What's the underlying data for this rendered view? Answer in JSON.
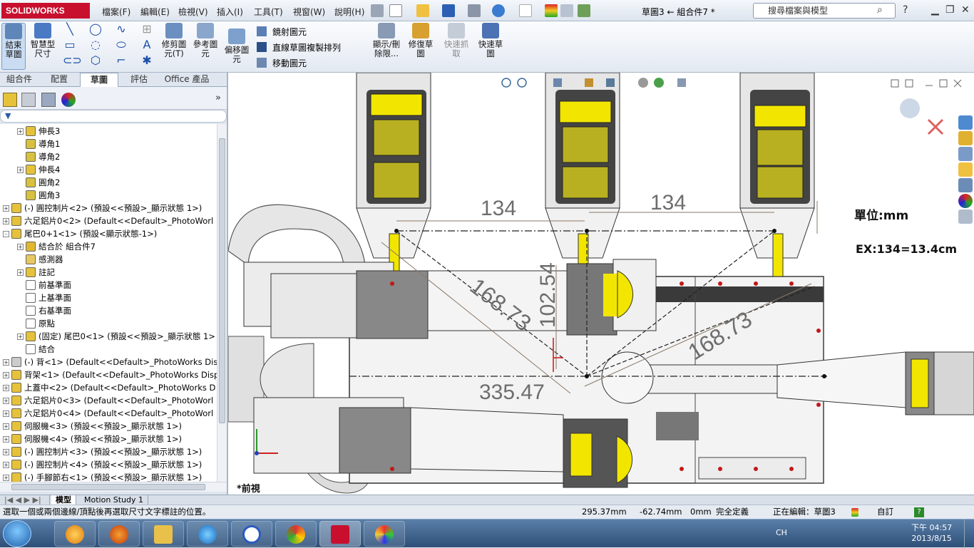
{
  "app": {
    "logo": "SOLIDWORKS",
    "menus": [
      "檔案(F)",
      "編輯(E)",
      "檢視(V)",
      "插入(I)",
      "工具(T)",
      "視窗(W)",
      "說明(H)"
    ],
    "doc_title": "草圖3 ← 組合件7 *",
    "search_placeholder": "搜尋檔案與模型"
  },
  "command_manager": {
    "exit_sketch": "結束草圖",
    "smart_dimension": "智慧型尺寸",
    "trim": "修剪圖元(T)",
    "convert": "參考圖元",
    "offset": "偏移圖元",
    "mirror": "鏡射圖元",
    "linear_pattern": "直線草圖複製排列",
    "move": "移動圖元",
    "display_delete": "顯示/刪除限...",
    "repair": "修復草圖",
    "quick_snap": "快速抓取",
    "rapid_sketch": "快速草圖"
  },
  "tabs": [
    "組合件",
    "配置",
    "草圖",
    "評估",
    "Office 產品"
  ],
  "active_tab": "草圖",
  "tree": [
    {
      "indent": 1,
      "label": "伸長3",
      "icon": "extrude",
      "expand": "+"
    },
    {
      "indent": 1,
      "label": "導角1",
      "icon": "chamfer",
      "expand": ""
    },
    {
      "indent": 1,
      "label": "導角2",
      "icon": "chamfer",
      "expand": ""
    },
    {
      "indent": 1,
      "label": "伸長4",
      "icon": "extrude",
      "expand": "+"
    },
    {
      "indent": 1,
      "label": "圓角2",
      "icon": "fillet",
      "expand": ""
    },
    {
      "indent": 1,
      "label": "圓角3",
      "icon": "fillet",
      "expand": ""
    },
    {
      "indent": 0,
      "label": "(-) 圓控制片<2> (預設<<預設>_顯示狀態 1>)",
      "icon": "part",
      "expand": "+"
    },
    {
      "indent": 0,
      "label": "六足鋁片0<2> (Default<<Default>_PhotoWorl",
      "icon": "part",
      "expand": "+"
    },
    {
      "indent": 0,
      "label": "尾巴0+1<1> (預設<顯示狀態-1>)",
      "icon": "asm",
      "expand": "-"
    },
    {
      "indent": 1,
      "label": "結合於 組合件7",
      "icon": "mates",
      "expand": "+"
    },
    {
      "indent": 1,
      "label": "感測器",
      "icon": "sensor",
      "expand": ""
    },
    {
      "indent": 1,
      "label": "註記",
      "icon": "annot",
      "expand": "+"
    },
    {
      "indent": 1,
      "label": "前基準面",
      "icon": "plane",
      "expand": ""
    },
    {
      "indent": 1,
      "label": "上基準面",
      "icon": "plane",
      "expand": ""
    },
    {
      "indent": 1,
      "label": "右基準面",
      "icon": "plane",
      "expand": ""
    },
    {
      "indent": 1,
      "label": "原點",
      "icon": "origin",
      "expand": ""
    },
    {
      "indent": 1,
      "label": "(固定) 尾巴0<1> (預設<<預設>_顯示狀態 1>",
      "icon": "part",
      "expand": "+"
    },
    {
      "indent": 1,
      "label": "結合",
      "icon": "mate",
      "expand": ""
    },
    {
      "indent": 0,
      "label": "(-) 背<1> (Default<<Default>_PhotoWorks Dis",
      "icon": "part-gray",
      "expand": "+"
    },
    {
      "indent": 0,
      "label": "背架<1> (Default<<Default>_PhotoWorks Disp",
      "icon": "part",
      "expand": "+"
    },
    {
      "indent": 0,
      "label": "上蓋中<2> (Default<<Default>_PhotoWorks D",
      "icon": "part",
      "expand": "+"
    },
    {
      "indent": 0,
      "label": "六足鋁片0<3> (Default<<Default>_PhotoWorl",
      "icon": "part",
      "expand": "+"
    },
    {
      "indent": 0,
      "label": "六足鋁片0<4> (Default<<Default>_PhotoWorl",
      "icon": "part",
      "expand": "+"
    },
    {
      "indent": 0,
      "label": "伺服機<3> (預設<<預設>_顯示狀態 1>)",
      "icon": "part",
      "expand": "+"
    },
    {
      "indent": 0,
      "label": "伺服機<4> (預設<<預設>_顯示狀態 1>)",
      "icon": "part",
      "expand": "+"
    },
    {
      "indent": 0,
      "label": "(-) 圓控制片<3> (預設<<預設>_顯示狀態 1>)",
      "icon": "part",
      "expand": "+"
    },
    {
      "indent": 0,
      "label": "(-) 圓控制片<4> (預設<<預設>_顯示狀態 1>)",
      "icon": "part",
      "expand": "+"
    },
    {
      "indent": 0,
      "label": "(-) 手腳節右<1> (預設<<預設>_顯示狀態 1>)",
      "icon": "part",
      "expand": "+"
    }
  ],
  "viewport": {
    "dims": [
      "134",
      "134",
      "168.73",
      "102.54",
      "168.73",
      "335.47"
    ],
    "note_unit": "單位:mm",
    "note_example": "EX:134=13.4cm",
    "view_label": "*前視"
  },
  "bottom_tabs": [
    "模型",
    "Motion Study 1"
  ],
  "status": {
    "message": "選取一個或兩個邊線/頂點後再選取尺寸文字標註的位置。",
    "x": "295.37mm",
    "y": "-62.74mm",
    "z": "0mm",
    "state": "完全定義",
    "editing": "正在編輯：草圖3",
    "units": "自訂"
  },
  "taskbar": {
    "lang": "CH",
    "time": "下午 04:57",
    "date": "2013/8/15"
  },
  "colors": {
    "brand": "#c8102e",
    "accent": "#1b4fa6",
    "dim": "#7a6a5a",
    "yellow": "#f2e600"
  }
}
